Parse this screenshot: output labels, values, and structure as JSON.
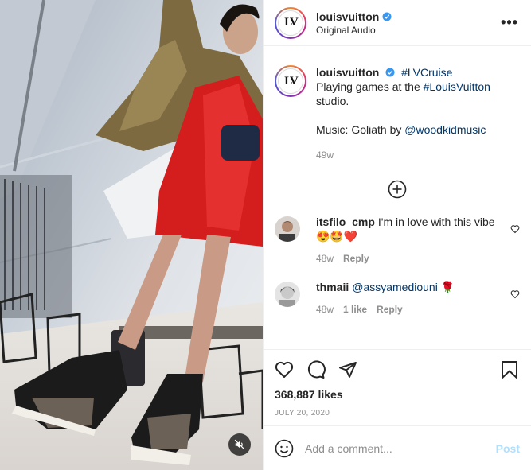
{
  "post": {
    "account": "louisvuitton",
    "audio": "Original Audio",
    "avatar_text": "LV",
    "more_label": "•••"
  },
  "caption": {
    "username": "louisvuitton",
    "hashtag1": "#LVCruise",
    "text_before": "Playing games at the ",
    "hashtag2": "#LouisVuitton",
    "text_after": "studio.",
    "music_prefix": "Music: Goliath by ",
    "mention": "@woodkidmusic",
    "age": "49w"
  },
  "comments": [
    {
      "username": "itsfilo_cmp",
      "text": "I'm in love with this vibe 😍🤩❤️",
      "age": "48w",
      "likes": "",
      "reply": "Reply"
    },
    {
      "username": "thmaii",
      "text": "@assyamediouni 🌹",
      "age": "48w",
      "likes": "1 like",
      "reply": "Reply"
    }
  ],
  "stats": {
    "likes": "368,887 likes",
    "date": "JULY 20, 2020"
  },
  "composer": {
    "placeholder": "Add a comment...",
    "post_label": "Post"
  },
  "icons": {
    "verified": "verified-badge-icon",
    "load_more": "plus-circle-icon",
    "like": "heart-icon",
    "comment": "comment-icon",
    "share": "share-icon",
    "save": "bookmark-icon",
    "emoji": "emoji-icon",
    "mute": "muted-speaker-icon"
  },
  "colors": {
    "link": "#00376b",
    "verified": "#3897f0",
    "post_disabled": "#b2dffc",
    "muted_text": "#8e8e8e"
  }
}
